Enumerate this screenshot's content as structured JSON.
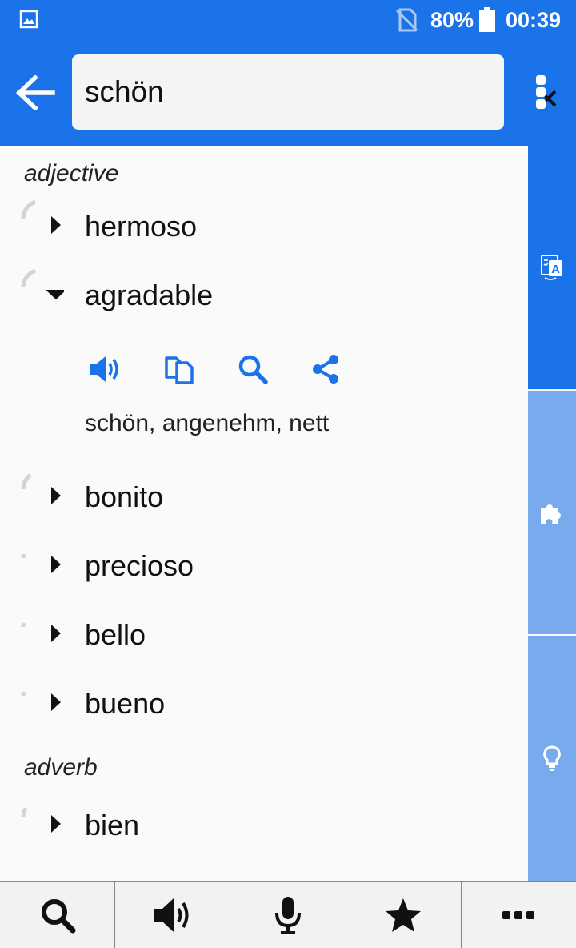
{
  "status_bar": {
    "battery_percent": "80%",
    "time": "00:39"
  },
  "search": {
    "query": "schön"
  },
  "entries": [
    {
      "part_of_speech": "adjective",
      "translations": [
        {
          "word": "hermoso",
          "expanded": false,
          "frequency": 0.8
        },
        {
          "word": "agradable",
          "expanded": true,
          "frequency": 0.8,
          "definition": "schön, angenehm, nett"
        },
        {
          "word": "bonito",
          "expanded": false,
          "frequency": 0.6
        },
        {
          "word": "precioso",
          "expanded": false,
          "frequency": 0.15
        },
        {
          "word": "bello",
          "expanded": false,
          "frequency": 0.15
        },
        {
          "word": "bueno",
          "expanded": false,
          "frequency": 0.15
        }
      ]
    },
    {
      "part_of_speech": "adverb",
      "translations": [
        {
          "word": "bien",
          "expanded": false,
          "frequency": 0.35
        }
      ]
    }
  ],
  "expanded_actions": [
    "speaker-icon",
    "copy-icon",
    "search-icon",
    "share-icon"
  ],
  "side_tabs": [
    "translate-icon",
    "puzzle-icon",
    "lightbulb-icon"
  ],
  "bottom_nav": [
    "search-icon",
    "speaker-icon",
    "microphone-icon",
    "star-icon",
    "more-icon"
  ],
  "colors": {
    "primary": "#1a73e8",
    "primary_light": "#7aaaee",
    "gauge": "#d4d4d4"
  }
}
